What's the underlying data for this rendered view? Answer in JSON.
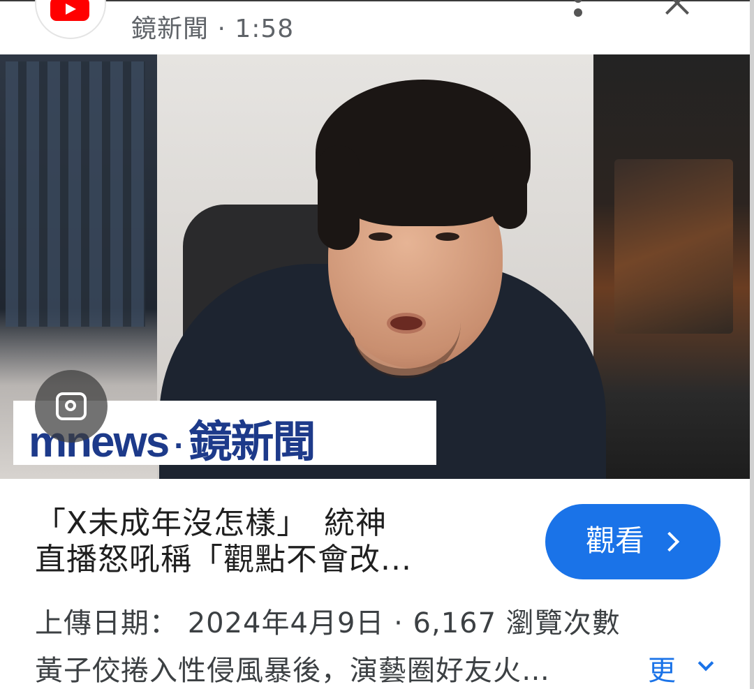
{
  "header": {
    "channel_name": "鏡新聞",
    "separator": "·",
    "duration": "1:58",
    "channel_meta": "鏡新聞 · 1:58"
  },
  "video": {
    "overlay_logo_text_a": "mnews",
    "overlay_logo_dot": "·",
    "overlay_logo_text_b": "鏡新聞"
  },
  "info": {
    "title_line1": "「X未成年沒怎樣」　統神",
    "title_line2": "直播怒吼稱「觀點不會改...",
    "watch_label": "觀看",
    "upload_line": "上傳日期： 2024年4月9日 · 6,167 瀏覽次數",
    "description": "黃子佼捲入性侵風暴後，演藝圈好友火…",
    "more_label": "更"
  },
  "colors": {
    "accent": "#1a73e8",
    "logo_blue": "#1d3a8a",
    "youtube_red": "#ff0000"
  },
  "icons": [
    "youtube-logo-icon",
    "more-vert-icon",
    "close-icon",
    "lens-search-icon",
    "chevron-right-icon",
    "chevron-down-icon"
  ]
}
